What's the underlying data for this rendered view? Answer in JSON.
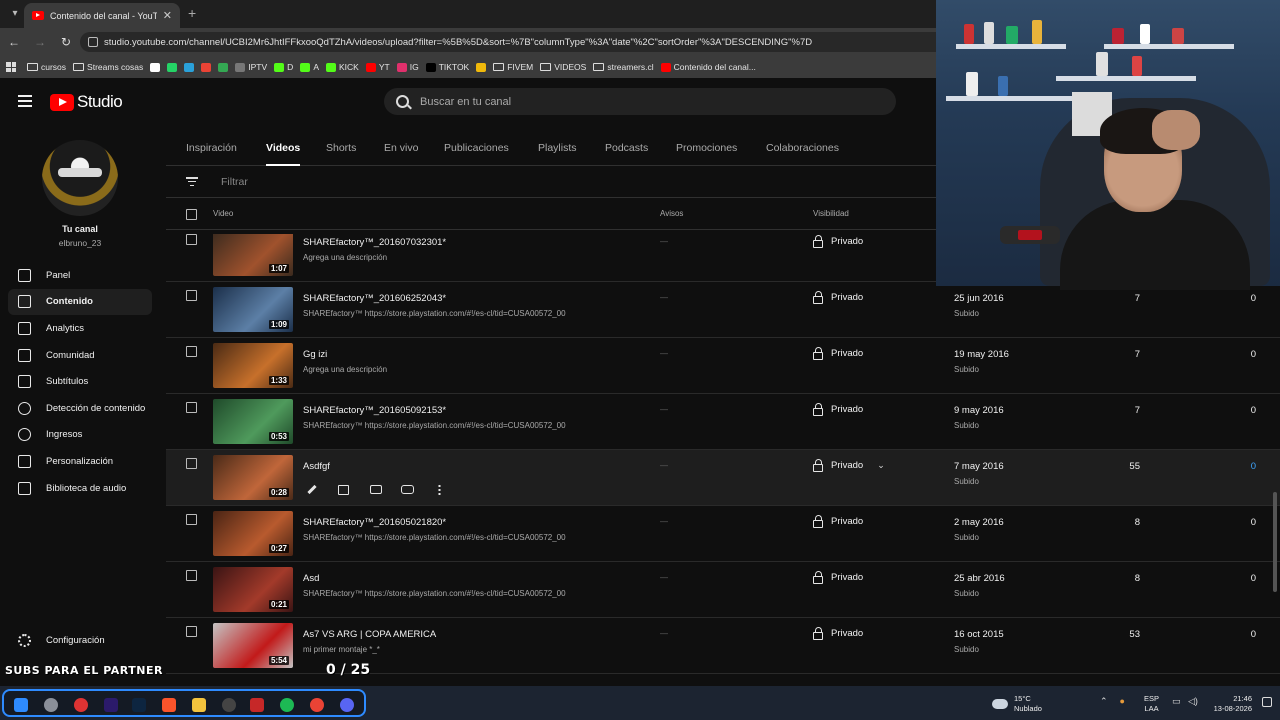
{
  "browser": {
    "tab_title": "Contenido del canal - YouTube",
    "url": "studio.youtube.com/channel/UCBI2Mr6JhtIFFkxooQdTZhA/videos/upload?filter=%5B%5D&sort=%7B\"columnType\"%3A\"date\"%2C\"sortOrder\"%3A\"DESCENDING\"%7D",
    "bookmarks": [
      {
        "label": "cursos",
        "kind": "folder"
      },
      {
        "label": "Streams cosas",
        "kind": "folder"
      },
      {
        "label": "",
        "kind": "icon",
        "color": "#ffffff"
      },
      {
        "label": "",
        "kind": "icon",
        "color": "#25d366"
      },
      {
        "label": "",
        "kind": "icon",
        "color": "#2aa1da"
      },
      {
        "label": "",
        "kind": "icon",
        "color": "#ea4335"
      },
      {
        "label": "",
        "kind": "icon",
        "color": "#34a853"
      },
      {
        "label": "IPTV",
        "kind": "icon",
        "color": "#777777"
      },
      {
        "label": "D",
        "kind": "icon",
        "color": "#53fc18"
      },
      {
        "label": "A",
        "kind": "icon",
        "color": "#53fc18"
      },
      {
        "label": "KICK",
        "kind": "icon",
        "color": "#53fc18"
      },
      {
        "label": "YT",
        "kind": "icon",
        "color": "#ff0000"
      },
      {
        "label": "IG",
        "kind": "icon",
        "color": "#e1306c"
      },
      {
        "label": "TIKTOK",
        "kind": "icon",
        "color": "#000000"
      },
      {
        "label": "",
        "kind": "icon",
        "color": "#f0b90b"
      },
      {
        "label": "FIVEM",
        "kind": "folder"
      },
      {
        "label": "VIDEOS",
        "kind": "folder"
      },
      {
        "label": "streamers.cl",
        "kind": "folder"
      },
      {
        "label": "Contenido del canal...",
        "kind": "icon",
        "color": "#ff0000"
      }
    ]
  },
  "header": {
    "logo_text": "Studio",
    "search_placeholder": "Buscar en tu canal"
  },
  "sidebar": {
    "channel_title": "Tu canal",
    "channel_handle": "elbruno_23",
    "items": [
      {
        "label": "Panel",
        "icon": "dashboard-icon"
      },
      {
        "label": "Contenido",
        "icon": "content-icon",
        "active": true
      },
      {
        "label": "Analytics",
        "icon": "analytics-icon"
      },
      {
        "label": "Comunidad",
        "icon": "community-icon"
      },
      {
        "label": "Subtítulos",
        "icon": "subtitles-icon"
      },
      {
        "label": "Detección de contenido",
        "icon": "copyright-icon"
      },
      {
        "label": "Ingresos",
        "icon": "earn-icon"
      },
      {
        "label": "Personalización",
        "icon": "customization-icon"
      },
      {
        "label": "Biblioteca de audio",
        "icon": "audio-library-icon"
      }
    ],
    "settings_label": "Configuración"
  },
  "tabs": [
    "Inspiración",
    "Videos",
    "Shorts",
    "En vivo",
    "Publicaciones",
    "Playlists",
    "Podcasts",
    "Promociones",
    "Colaboraciones"
  ],
  "active_tab": "Videos",
  "filter_placeholder": "Filtrar",
  "columns": {
    "video": "Video",
    "restrictions": "Avisos",
    "visibility": "Visibilidad"
  },
  "rows": [
    {
      "title": "SHAREfactory™_201607032301*",
      "desc": "Agrega una descripción",
      "duration": "1:07",
      "restrictions": "—",
      "visibility": "Privado",
      "date": "",
      "status": "",
      "views": "",
      "comments": "",
      "thumb": [
        "#3a2a1e",
        "#a0522d"
      ]
    },
    {
      "title": "SHAREfactory™_201606252043*",
      "desc": "SHAREfactory™ https://store.playstation.com/#!/es-cl/tid=CUSA00572_00",
      "duration": "1:09",
      "restrictions": "—",
      "visibility": "Privado",
      "date": "25 jun 2016",
      "status": "Subido",
      "views": "7",
      "comments": "0",
      "thumb": [
        "#1b2f4a",
        "#5c7fa6"
      ]
    },
    {
      "title": "Gg izi",
      "desc": "Agrega una descripción",
      "duration": "1:33",
      "restrictions": "—",
      "visibility": "Privado",
      "date": "19 may 2016",
      "status": "Subido",
      "views": "7",
      "comments": "0",
      "thumb": [
        "#4a2a14",
        "#c7702b"
      ]
    },
    {
      "title": "SHAREfactory™_201605092153*",
      "desc": "SHAREfactory™ https://store.playstation.com/#!/es-cl/tid=CUSA00572_00",
      "duration": "0:53",
      "restrictions": "—",
      "visibility": "Privado",
      "date": "9 may 2016",
      "status": "Subido",
      "views": "7",
      "comments": "0",
      "thumb": [
        "#1f4a2a",
        "#4f9a5c"
      ]
    },
    {
      "title": "Asdfgf",
      "desc": "",
      "duration": "0:28",
      "restrictions": "—",
      "visibility": "Privado",
      "date": "7 may 2016",
      "status": "Subido",
      "views": "55",
      "comments": "0",
      "thumb": [
        "#4a2a18",
        "#c0663a"
      ],
      "hover": true
    },
    {
      "title": "SHAREfactory™_201605021820*",
      "desc": "SHAREfactory™ https://store.playstation.com/#!/es-cl/tid=CUSA00572_00",
      "duration": "0:27",
      "restrictions": "—",
      "visibility": "Privado",
      "date": "2 may 2016",
      "status": "Subido",
      "views": "8",
      "comments": "0",
      "thumb": [
        "#4a2414",
        "#b85a2e"
      ]
    },
    {
      "title": "Asd",
      "desc": "SHAREfactory™ https://store.playstation.com/#!/es-cl/tid=CUSA00572_00",
      "duration": "0:21",
      "restrictions": "—",
      "visibility": "Privado",
      "date": "25 abr 2016",
      "status": "Subido",
      "views": "8",
      "comments": "0",
      "thumb": [
        "#3a1414",
        "#a33a2a"
      ]
    },
    {
      "title": "As7 VS ARG | COPA AMERICA",
      "desc": "mi primer montaje *_*",
      "duration": "5:54",
      "restrictions": "—",
      "visibility": "Privado",
      "date": "16 oct 2015",
      "status": "Subido",
      "views": "53",
      "comments": "0",
      "thumb": [
        "#c4c4c4",
        "#c21a1a"
      ]
    }
  ],
  "overlay": {
    "left_text": "SUBS PARA EL PARTNER",
    "count_text": "0 / 25"
  },
  "taskbar": {
    "weather_temp": "15°C",
    "weather_desc": "Nublado",
    "lang_top": "ESP",
    "lang_bottom": "LAA",
    "time": "21:46",
    "date": "13-08-2026"
  }
}
